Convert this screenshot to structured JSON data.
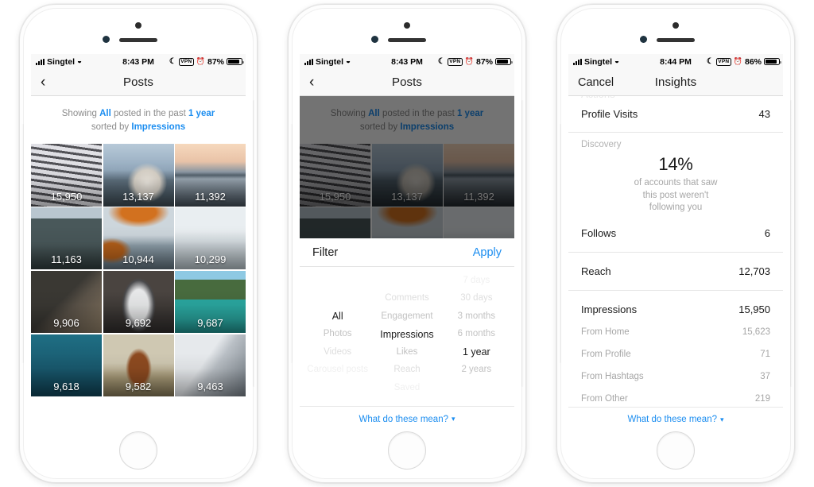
{
  "phone1": {
    "status": {
      "carrier": "Singtel",
      "time": "8:43 PM",
      "vpn": "VPN",
      "battery": "87%"
    },
    "nav": {
      "title": "Posts",
      "back_icon": "chevron-left-icon"
    },
    "banner": {
      "line1_a": "Showing ",
      "line1_filter": "All",
      "line1_b": " posted in the past ",
      "line1_period": "1 year",
      "line2_a": "sorted by ",
      "line2_metric": "Impressions"
    },
    "grid": [
      {
        "value": "15,950",
        "alt": "curved-building"
      },
      {
        "value": "13,137",
        "alt": "dog-by-lake"
      },
      {
        "value": "11,392",
        "alt": "mount-fuji-reflection"
      },
      {
        "value": "11,163",
        "alt": "city-street-taxis"
      },
      {
        "value": "10,944",
        "alt": "autumn-lake"
      },
      {
        "value": "10,299",
        "alt": "castle-in-snow"
      },
      {
        "value": "9,906",
        "alt": "puppy-in-camera-bag"
      },
      {
        "value": "9,692",
        "alt": "husky-on-street"
      },
      {
        "value": "9,687",
        "alt": "turquoise-canyon-river"
      },
      {
        "value": "9,618",
        "alt": "island-with-red-house"
      },
      {
        "value": "9,582",
        "alt": "highland-calf"
      },
      {
        "value": "9,463",
        "alt": "desk-workspace"
      }
    ]
  },
  "phone2": {
    "status": {
      "carrier": "Singtel",
      "time": "8:43 PM",
      "vpn": "VPN",
      "battery": "87%"
    },
    "nav": {
      "title": "Posts",
      "back_icon": "chevron-left-icon"
    },
    "filter_sheet": {
      "title": "Filter",
      "apply": "Apply",
      "columns": [
        {
          "name": "content-type",
          "options": [
            "",
            "",
            "All",
            "Photos",
            "Videos",
            "Carousel posts"
          ],
          "selected_index": 2
        },
        {
          "name": "metric",
          "options": [
            "",
            "Comments",
            "Engagement",
            "Impressions",
            "Likes",
            "Reach",
            "Saved"
          ],
          "selected_index": 3
        },
        {
          "name": "time-period",
          "options": [
            "7 days",
            "30 days",
            "3 months",
            "6 months",
            "1 year",
            "2 years"
          ],
          "selected_index": 4
        }
      ],
      "footer": "What do these mean?",
      "footer_icon": "chevron-down-icon"
    }
  },
  "phone3": {
    "status": {
      "carrier": "Singtel",
      "time": "8:44 PM",
      "vpn": "VPN",
      "battery": "86%"
    },
    "nav": {
      "cancel": "Cancel",
      "title": "Insights"
    },
    "rows": {
      "profile_visits_label": "Profile Visits",
      "profile_visits_value": "43",
      "discovery_label": "Discovery",
      "discovery_pct": "14%",
      "discovery_desc_1": "of accounts that saw",
      "discovery_desc_2": "this post weren't",
      "discovery_desc_3": "following you",
      "follows_label": "Follows",
      "follows_value": "6",
      "reach_label": "Reach",
      "reach_value": "12,703",
      "impressions_label": "Impressions",
      "impressions_value": "15,950",
      "breakdown": [
        {
          "label": "From Home",
          "value": "15,623"
        },
        {
          "label": "From Profile",
          "value": "71"
        },
        {
          "label": "From Hashtags",
          "value": "37"
        },
        {
          "label": "From Other",
          "value": "219"
        }
      ]
    },
    "footer": "What do these mean?",
    "footer_icon": "chevron-down-icon"
  },
  "colors": {
    "accent": "#1b8df0",
    "muted": "#a6a6a6",
    "text": "#1a1a1a",
    "chrome": "#f8f8f8"
  }
}
